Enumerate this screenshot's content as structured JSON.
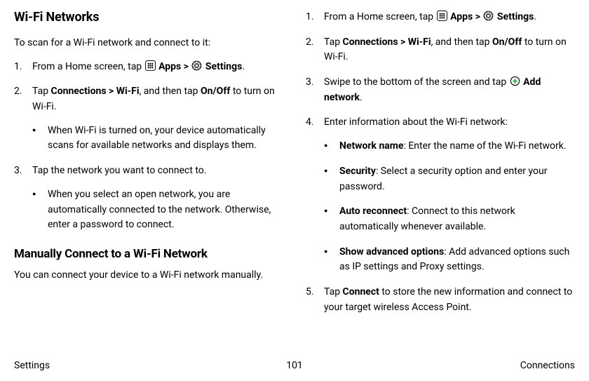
{
  "left": {
    "h1": "Wi-Fi Networks",
    "intro": "To scan for a Wi-Fi network and connect to it:",
    "s1_a": "From a Home screen, tap ",
    "s1_apps": " Apps",
    "s1_gt": " > ",
    "s1_settings": " Settings",
    "s1_end": ".",
    "s2_a": "Tap ",
    "s2_conn": "Connections > Wi-Fi",
    "s2_b": ", and then tap ",
    "s2_onoff": "On/Off",
    "s2_c": " to turn on Wi-Fi.",
    "s2_bullet": "When Wi-Fi is turned on, your device automatically scans for available networks and displays them.",
    "s3": "Tap the network you want to connect to.",
    "s3_bullet": "When you select an open network, you are automatically connected to the network. Otherwise, enter a password to connect.",
    "h2": "Manually Connect to a Wi-Fi Network",
    "manual_intro": "You can connect your device to a Wi-Fi network manually."
  },
  "right": {
    "s1_a": "From a Home screen, tap ",
    "s1_apps": " Apps",
    "s1_gt": " > ",
    "s1_settings": " Settings",
    "s1_end": ".",
    "s2_a": "Tap ",
    "s2_conn": "Connections > Wi-Fi",
    "s2_b": ", and then tap ",
    "s2_onoff": "On/Off",
    "s2_c": " to turn on Wi-Fi.",
    "s3_a": "Swipe to the bottom of the screen and tap ",
    "s3_add": " Add network",
    "s3_end": ".",
    "s4": "Enter information about the Wi-Fi network:",
    "b1_label": "Network name",
    "b1_text": ": Enter the name of the Wi-Fi network.",
    "b2_label": "Security",
    "b2_text": ": Select a security option and enter your password.",
    "b3_label": "Auto reconnect",
    "b3_text": ": Connect to this network automatically whenever available.",
    "b4_label": "Show advanced options",
    "b4_text": ": Add advanced options such as IP settings and Proxy settings.",
    "s5_a": "Tap ",
    "s5_connect": "Connect",
    "s5_b": " to store the new information and connect to your target wireless Access Point."
  },
  "footer": {
    "left": "Settings",
    "center": "101",
    "right": "Connections"
  }
}
